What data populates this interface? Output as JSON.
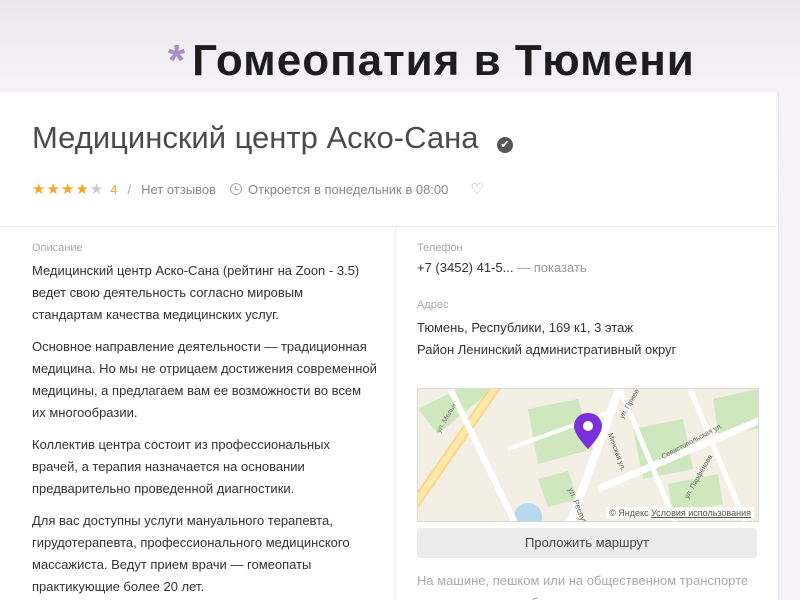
{
  "slide": {
    "title": "Гомеопатия в Тюмени",
    "bullet": "*"
  },
  "org": {
    "name": "Медицинский центр Аско-Сана",
    "rating": "4",
    "stars_filled": 4,
    "stars_total": 5,
    "reviews": "Нет отзывов",
    "hours": "Откроется в понедельник в 08:00",
    "rating_sep": "/"
  },
  "description": {
    "label": "Описание",
    "paragraphs": [
      "Медицинский центр Аско-Сана (рейтинг на Zoon - 3.5) ведет свою деятельность согласно мировым стандартам качества медицинских услуг.",
      "Основное направление деятельности — традиционная медицина. Но мы не отрицаем достижения современной медицины, а предлагаем вам ее возможности во всем их многообразии.",
      "Коллектив центра состоит из профессиональных врачей, а терапия назначается на основании предварительно проведенной диагностики.",
      "Для вас доступны услуги мануального терапевта, гирудотерапевта, профессионального медицинского массажиста. Ведут прием врачи — гомеопаты практикующие более 20 лет."
    ]
  },
  "contacts": {
    "phone_label": "Телефон",
    "phone": "+7 (3452) 41-5...",
    "phone_show": "— показать",
    "address_label": "Адрес",
    "address_line1": "Тюмень, Республики, 169 к1, 3 этаж",
    "address_line2": "Район Ленинский административный округ"
  },
  "map": {
    "copyright": "© Яндекс",
    "terms": "Условия использования",
    "streets": [
      "ул. Мельн",
      "ул. Республики",
      "Севастопольская ул.",
      "ул. Парфёнова",
      "ул. Пржев",
      "Минская ул."
    ]
  },
  "route_button": "Проложить маршрут",
  "transport_text": "На машине, пешком или на общественном транспорте — показать, как добраться"
}
